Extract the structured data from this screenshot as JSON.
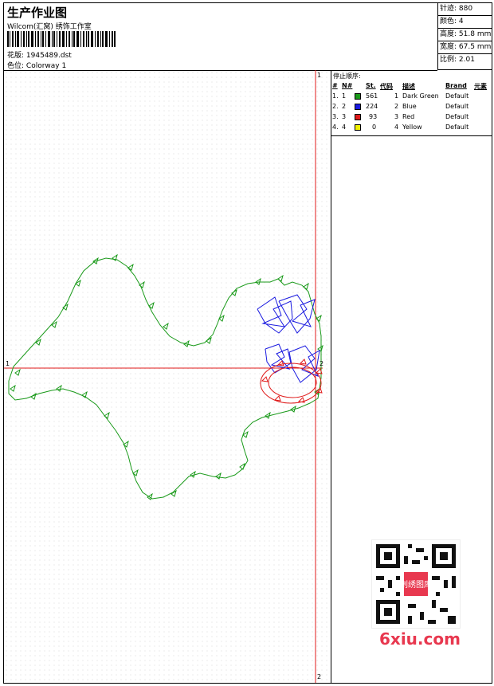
{
  "header": {
    "title": "生产作业图",
    "studio": "Wilcom(汇窝) 绣饰工作室",
    "design_label": "花版:",
    "design_value": "1945489.dst",
    "colorway_label": "色位:",
    "colorway_value": "Colorway 1"
  },
  "stats": {
    "stitches_label": "针迹:",
    "stitches_value": "880",
    "colors_label": "颜色:",
    "colors_value": "4",
    "height_label": "高度:",
    "height_value": "51.8 mm",
    "width_label": "宽度:",
    "width_value": "67.5 mm",
    "scale_label": "比例:",
    "scale_value": "2.01"
  },
  "markers": {
    "top": "1",
    "left": "1",
    "right": "2",
    "bottom": "2"
  },
  "stop_sequence": {
    "title": "停止顺序:",
    "columns": [
      "#",
      "N#",
      "St.",
      "代码",
      "描述",
      "Brand",
      "元素"
    ],
    "rows": [
      {
        "idx": "1.",
        "n": "1",
        "st": "561",
        "code": "1",
        "desc": "Dark Green",
        "brand": "Default",
        "color": "#1a9a1a"
      },
      {
        "idx": "2.",
        "n": "2",
        "st": "224",
        "code": "2",
        "desc": "Blue",
        "brand": "Default",
        "color": "#1a1ae0"
      },
      {
        "idx": "3.",
        "n": "3",
        "st": "93",
        "code": "3",
        "desc": "Red",
        "brand": "Default",
        "color": "#e01a1a"
      },
      {
        "idx": "4.",
        "n": "4",
        "st": "0",
        "code": "4",
        "desc": "Yellow",
        "brand": "Default",
        "color": "#f0f000"
      }
    ]
  },
  "colors": {
    "crosshair": "#e01a1a",
    "green": "#1a9a1a",
    "blue": "#1a1ae0",
    "red": "#e01a1a",
    "logo": "#e8384f"
  },
  "watermark": {
    "logo_text": "6xiu.com",
    "qr_label": "刺绣图库"
  }
}
